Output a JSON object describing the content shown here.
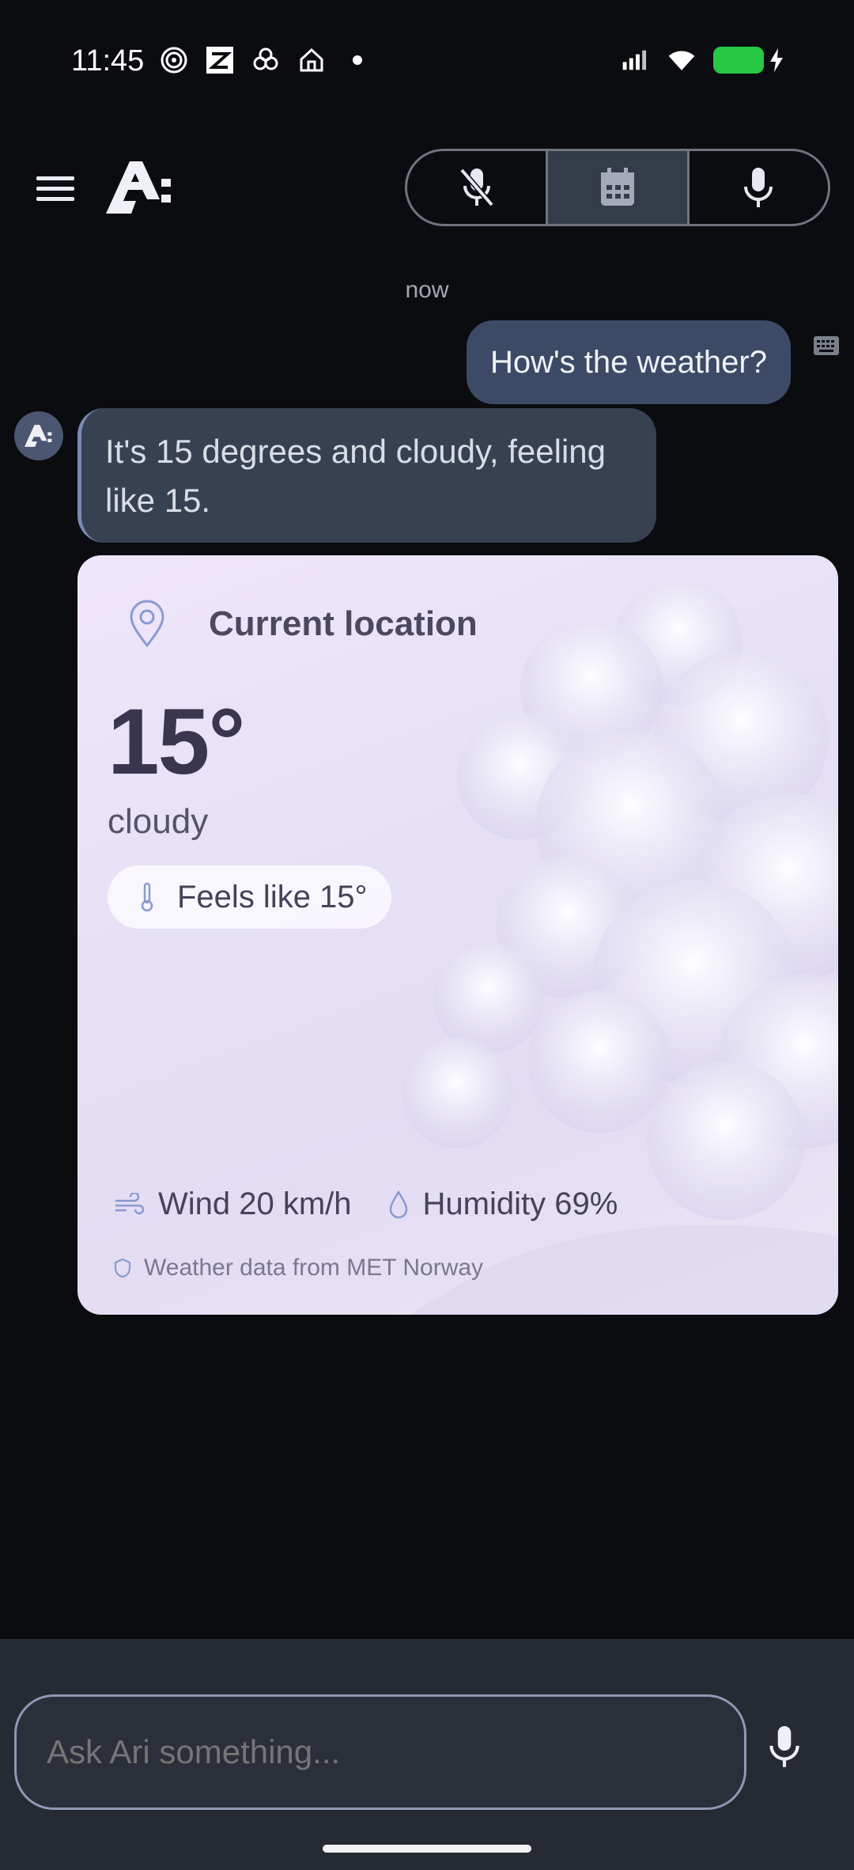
{
  "status_bar": {
    "time": "11:45",
    "left_icons": [
      "spiral-icon",
      "zepp-icon",
      "openai-icon",
      "home-icon",
      "dot-icon"
    ],
    "right_icons": [
      "signal-icon",
      "wifi-icon",
      "battery-charging-icon"
    ],
    "battery_color": "#27c744"
  },
  "header": {
    "menu_icon": "hamburger-icon",
    "logo": "ari-logo",
    "segments": [
      {
        "icon": "mic-off-icon",
        "active": false
      },
      {
        "icon": "calendar-icon",
        "active": true
      },
      {
        "icon": "mic-icon",
        "active": false
      }
    ]
  },
  "chat": {
    "timestamp": "now",
    "user_message": "How's the weather?",
    "input_method_icon": "keyboard-icon",
    "assistant_message": "It's 15 degrees and cloudy, feeling like 15."
  },
  "weather": {
    "location": "Current location",
    "temperature": "15°",
    "condition": "cloudy",
    "feels_like": "Feels like 15°",
    "wind": "Wind 20 km/h",
    "humidity": "Humidity 69%",
    "source": "Weather data from MET Norway"
  },
  "composer": {
    "placeholder": "Ask Ari something...",
    "mic_icon": "mic-icon"
  },
  "colors": {
    "background": "#0b0c10",
    "user_bubble": "#3d4a66",
    "assistant_bubble": "#384152",
    "active_segment": "#343b49"
  }
}
